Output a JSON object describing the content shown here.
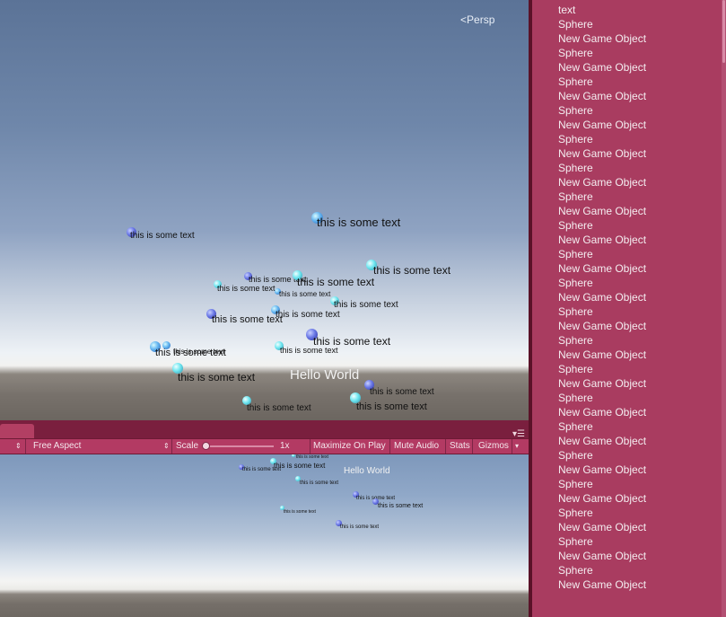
{
  "scene_view": {
    "projection_label": "Persp",
    "objects": [
      {
        "label": "this is some text",
        "style": "s1"
      },
      {
        "label": "this is some text",
        "style": "s2"
      },
      {
        "label": "this is some text",
        "style": "s3"
      },
      {
        "label": "this is some text",
        "style": "s4"
      },
      {
        "label": "this is some text",
        "style": "s5"
      },
      {
        "label": "this is some text",
        "style": "s6"
      },
      {
        "label": "this is some text",
        "style": "s7"
      },
      {
        "label": "this is some text",
        "style": "s8"
      },
      {
        "label": "this is some text",
        "style": "s9"
      },
      {
        "label": "this is some text",
        "style": "s10"
      },
      {
        "label": "this is some text",
        "style": "s11"
      },
      {
        "label": "this is some text",
        "style": "s12"
      },
      {
        "label": "this is some text",
        "style": "s13"
      },
      {
        "label": "this is some text",
        "style": "s14"
      },
      {
        "label": "this is some text",
        "style": "s15"
      },
      {
        "label": "this is some text",
        "style": "s16"
      },
      {
        "label": "this is some text",
        "style": "s17"
      },
      {
        "label": "this is some text",
        "style": "s18"
      }
    ],
    "hello_text": "Hello World"
  },
  "game_toolbar": {
    "aspect": "Free Aspect",
    "scale_label": "Scale",
    "scale_value": "1x",
    "maximize_on_play": "Maximize On Play",
    "mute_audio": "Mute Audio",
    "stats": "Stats",
    "gizmos": "Gizmos"
  },
  "game_view": {
    "objects": [
      {
        "label": "this is some text",
        "style": "g1"
      },
      {
        "label": "this is some text",
        "style": "g2"
      },
      {
        "label": "this is some text",
        "style": "g3"
      },
      {
        "label": "this is some text",
        "style": "g4"
      },
      {
        "label": "this is some text",
        "style": "g5"
      },
      {
        "label": "this is some text",
        "style": "g6"
      },
      {
        "label": "this is some text",
        "style": "g7"
      },
      {
        "label": "this is some text",
        "style": "g8"
      }
    ],
    "hello_text": "Hello World"
  },
  "hierarchy": {
    "items": [
      "text",
      "Sphere",
      "New Game Object",
      "Sphere",
      "New Game Object",
      "Sphere",
      "New Game Object",
      "Sphere",
      "New Game Object",
      "Sphere",
      "New Game Object",
      "Sphere",
      "New Game Object",
      "Sphere",
      "New Game Object",
      "Sphere",
      "New Game Object",
      "Sphere",
      "New Game Object",
      "Sphere",
      "New Game Object",
      "Sphere",
      "New Game Object",
      "Sphere",
      "New Game Object",
      "Sphere",
      "New Game Object",
      "Sphere",
      "New Game Object",
      "Sphere",
      "New Game Object",
      "Sphere",
      "New Game Object",
      "Sphere",
      "New Game Object",
      "Sphere",
      "New Game Object",
      "Sphere",
      "New Game Object",
      "Sphere",
      "New Game Object"
    ]
  }
}
